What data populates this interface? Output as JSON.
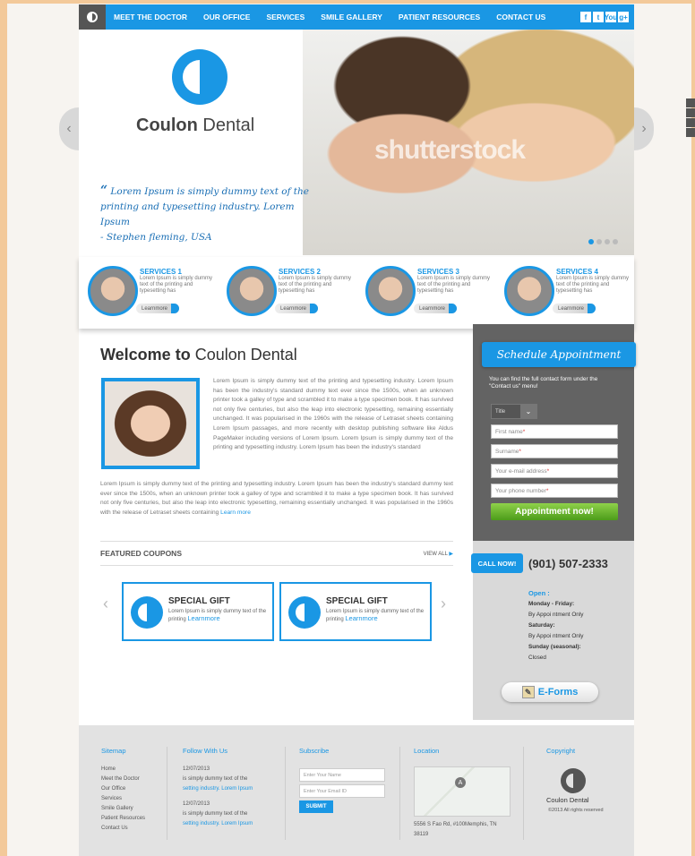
{
  "nav": {
    "items": [
      "MEET THE DOCTOR",
      "OUR OFFICE",
      "SERVICES",
      "SMILE GALLERY",
      "PATIENT RESOURCES",
      "CONTACT US"
    ],
    "social": [
      "f",
      "t",
      "You",
      "g+"
    ]
  },
  "hero": {
    "brand_bold": "Coulon",
    "brand_light": " Dental",
    "quote_mark": "“",
    "quote_text": "Lorem Ipsum is simply dummy text of the printing and typesetting industry. Lorem Ipsum",
    "quote_author": "- Stephen fleming, USA",
    "watermark": "shutterstock"
  },
  "services": [
    {
      "title": "SERVICES 1",
      "desc": "Lorem Ipsum is simply dummy text of the printing and typesetting has",
      "more": "Learnmore"
    },
    {
      "title": "SERVICES 2",
      "desc": "Lorem Ipsum is simply dummy text of the printing and typesetting has",
      "more": "Learnmore"
    },
    {
      "title": "SERVICES 3",
      "desc": "Lorem Ipsum is simply dummy text of the printing and typesetting has",
      "more": "Learnmore"
    },
    {
      "title": "SERVICES 4",
      "desc": "Lorem Ipsum is simply dummy text of the printing and typesetting has",
      "more": "Learnmore"
    }
  ],
  "welcome": {
    "title_bold": "Welcome to",
    "title_light": " Coulon Dental",
    "para1": "Lorem Ipsum is simply dummy text of the printing and typesetting industry. Lorem Ipsum has been the industry's standard dummy text ever since the 1500s, when an unknown printer took a galley of type and scrambled it to make a type specimen book. It has survived not only five centuries, but also the leap into electronic typesetting, remaining essentially unchanged. It was popularised in the 1960s with the release of Letraset sheets containing Lorem Ipsum passages, and more recently with desktop publishing software like Aldus PageMaker including versions of Lorem Ipsum. Lorem Ipsum is simply dummy text of the printing and typesetting industry. Lorem Ipsum has been the industry's standard",
    "para2": "Lorem Ipsum is simply dummy text of the printing and typesetting industry. Lorem Ipsum has been the industry's standard dummy text ever since the 1500s, when an unknown printer took a galley of type and scrambled it to make a type specimen book. It has survived not only five centuries, but also the leap into electronic typesetting, remaining essentially unchanged. It was popularised in the 1960s with the release of Letraset sheets containing",
    "learn_more": "Learn more"
  },
  "coupons": {
    "heading": "FEATURED COUPONS",
    "view_all": "VIEW ALL",
    "items": [
      {
        "title": "SPECIAL GIFT",
        "desc": "Lorem Ipsum is simply dummy text of the printing",
        "more": "Learnmore"
      },
      {
        "title": "SPECIAL GIFT",
        "desc": "Lorem Ipsum is simply dummy text of the printing",
        "more": "Learnmore"
      }
    ]
  },
  "appointment": {
    "banner": "Schedule Appointment",
    "note": "You can find the full contact form under the \"Contact us\" menu!",
    "title_select": "Title",
    "first_name": "First name",
    "surname": "Surname",
    "email": "Your e-mail address",
    "phone": "Your phone number",
    "button": "Appointment now!"
  },
  "contact": {
    "call_now": "CALL NOW!",
    "phone": "(901) 507-2333",
    "open_label": "Open :",
    "weekdays": "Monday - Friday:",
    "weekdays_val": "By Appoi ntment Only",
    "saturday": "Saturday:",
    "saturday_val": "By Appoi ntment Only",
    "sunday": "Sunday (seasonal):",
    "sunday_val": "Closed",
    "eforms": "E-Forms"
  },
  "footer": {
    "sitemap_heading": "Sitemap",
    "sitemap": [
      "Home",
      "Meet the Doctor",
      "Our Office",
      "Services",
      "Smile Gallery",
      "Patient Resources",
      "Contact Us"
    ],
    "follow_heading": "Follow With Us",
    "follow": [
      {
        "date": "12/07/2013",
        "text": "is simply dummy text of the",
        "link": "setting industry. Lorem Ipsum"
      },
      {
        "date": "12/07/2013",
        "text": "is simply dummy text of the",
        "link": "setting industry. Lorem Ipsum"
      }
    ],
    "subscribe_heading": "Subscribe",
    "name_placeholder": "Enter Your Name",
    "email_placeholder": "Enter Your Email ID",
    "submit": "SUBMIT",
    "location_heading": "Location",
    "address": "5556 S Fao Rd, #100Memphis, TN 38119",
    "map_pin": "A",
    "copyright_heading": "Copyright",
    "copyright_brand": "Coulon Dental",
    "copyright_text": "©2013 All rights reserved"
  }
}
